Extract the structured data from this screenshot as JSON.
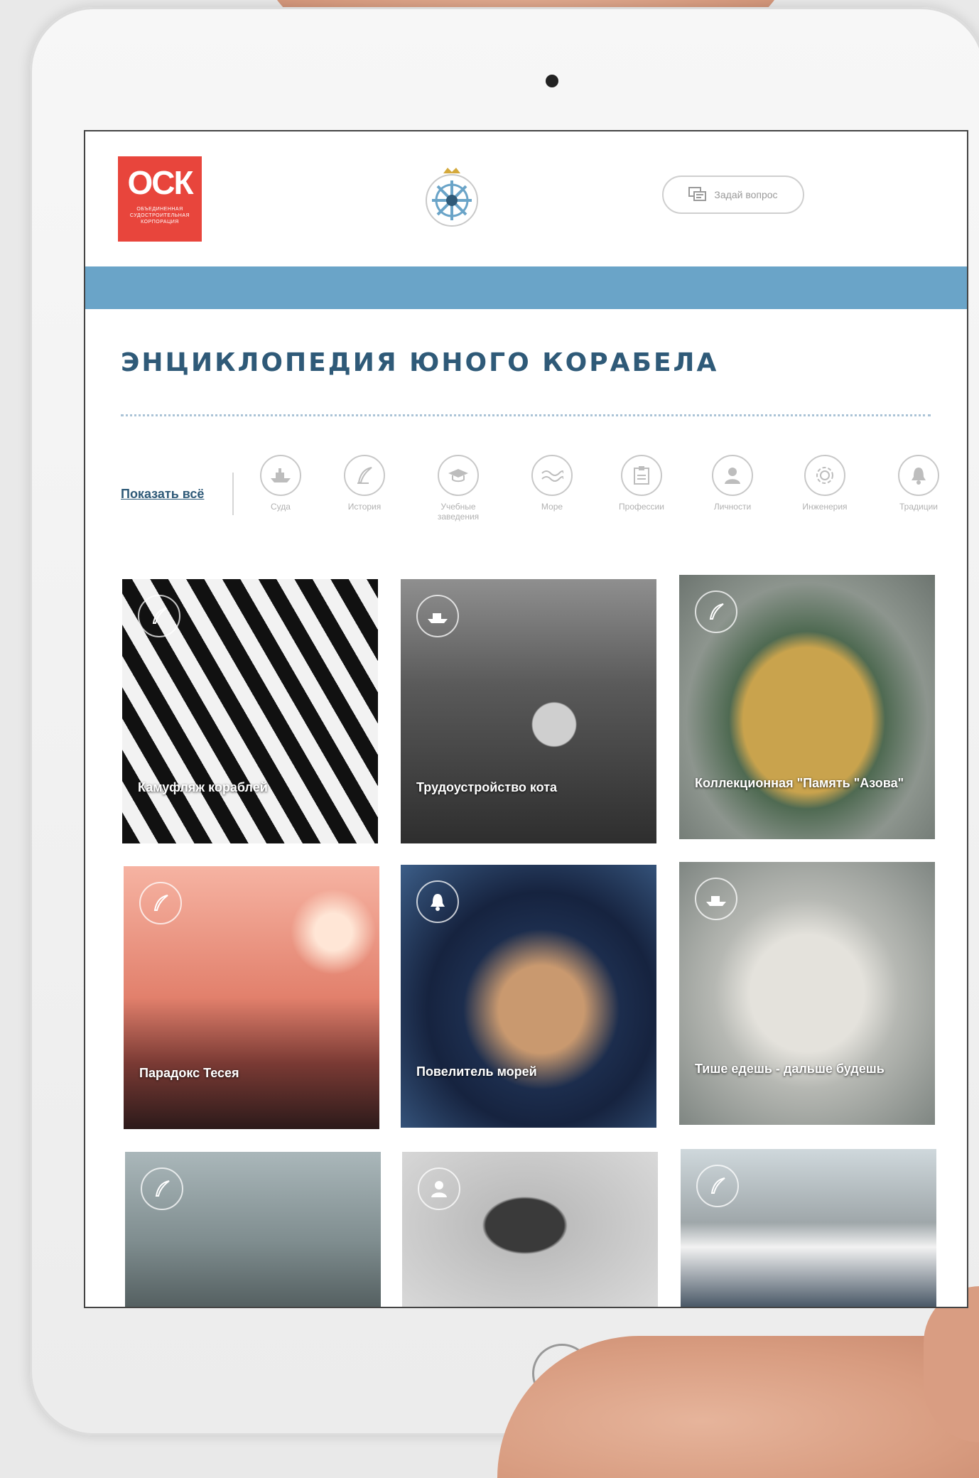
{
  "header": {
    "logo_mark": "ОСК",
    "logo_subtitle": "ОБЪЕДИНЕННАЯ СУДОСТРОИТЕЛЬНАЯ КОРПОРАЦИЯ",
    "ask_label": "Задай вопрос"
  },
  "page": {
    "title": "ЭНЦИКЛОПЕДИЯ ЮНОГО КОРАБЕЛА",
    "show_all": "Показать всё"
  },
  "categories": [
    {
      "label": "Суда",
      "icon": "ship-icon"
    },
    {
      "label": "История",
      "icon": "quill-icon"
    },
    {
      "label": "Учебные заведения",
      "icon": "graduation-cap-icon"
    },
    {
      "label": "Море",
      "icon": "wave-icon"
    },
    {
      "label": "Профессии",
      "icon": "clipboard-icon"
    },
    {
      "label": "Личности",
      "icon": "bust-icon"
    },
    {
      "label": "Инженерия",
      "icon": "gear-icon"
    },
    {
      "label": "Традиции",
      "icon": "bell-icon"
    }
  ],
  "cards": [
    {
      "title": "Камуфляж кораблей",
      "icon": "quill-icon"
    },
    {
      "title": "Трудоустройство кота",
      "icon": "ship-icon"
    },
    {
      "title": "Коллекционная \"Память \"Азова\"",
      "icon": "quill-icon"
    },
    {
      "title": "Парадокс Тесея",
      "icon": "quill-icon"
    },
    {
      "title": "Повелитель морей",
      "icon": "bell-icon"
    },
    {
      "title": "Тише едешь - дальше будешь",
      "icon": "ship-icon"
    },
    {
      "title": "",
      "icon": "quill-icon"
    },
    {
      "title": "",
      "icon": "bust-icon"
    },
    {
      "title": "",
      "icon": "quill-icon"
    }
  ],
  "colors": {
    "brand_red": "#e8453c",
    "band_blue": "#6aa4c8",
    "title_blue": "#2f5a78"
  }
}
